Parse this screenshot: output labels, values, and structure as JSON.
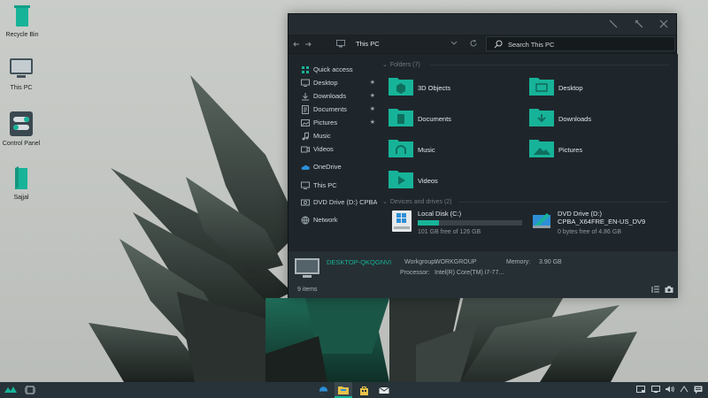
{
  "desktop": {
    "icons": [
      {
        "label": "Recycle Bin"
      },
      {
        "label": "This PC"
      },
      {
        "label": "Control Panel"
      },
      {
        "label": "Sajjal"
      }
    ]
  },
  "window": {
    "controls": [
      "minimize",
      "maximize",
      "close"
    ],
    "address": {
      "location": "This PC"
    },
    "search": {
      "placeholder": "Search This PC"
    },
    "sidebar": [
      {
        "label": "Quick access",
        "icon": "star-icon",
        "pinned": false
      },
      {
        "label": "Desktop",
        "icon": "desktop-icon",
        "pinned": true
      },
      {
        "label": "Downloads",
        "icon": "download-icon",
        "pinned": true
      },
      {
        "label": "Documents",
        "icon": "document-icon",
        "pinned": true
      },
      {
        "label": "Pictures",
        "icon": "picture-icon",
        "pinned": true
      },
      {
        "label": "Music",
        "icon": "music-icon",
        "pinned": false
      },
      {
        "label": "Videos",
        "icon": "video-icon",
        "pinned": false
      },
      {
        "label": "OneDrive",
        "icon": "cloud-icon",
        "pinned": false
      },
      {
        "label": "This PC",
        "icon": "computer-icon",
        "pinned": false
      },
      {
        "label": "DVD Drive (D:) CPBA_",
        "icon": "dvd-icon",
        "pinned": false
      },
      {
        "label": "Network",
        "icon": "network-icon",
        "pinned": false
      }
    ],
    "pin_glyph": "★",
    "folders_header": "Folders (7)",
    "folders": [
      {
        "label": "3D Objects",
        "glyph": "cube"
      },
      {
        "label": "Desktop",
        "glyph": "desktop"
      },
      {
        "label": "Documents",
        "glyph": "doc"
      },
      {
        "label": "Downloads",
        "glyph": "down"
      },
      {
        "label": "Music",
        "glyph": "headphones"
      },
      {
        "label": "Pictures",
        "glyph": "mountain"
      },
      {
        "label": "Videos",
        "glyph": "play"
      }
    ],
    "devices_header": "Devices and drives (2)",
    "drives": [
      {
        "name": "Local Disk (C:)",
        "free_text": "101 GB free of 126 GB",
        "used_fraction": 0.2
      },
      {
        "name": "DVD Drive (D:)",
        "sub": "CPBA_X64FRE_EN-US_DV9",
        "free_text": "0 bytes free of 4.86 GB"
      }
    ],
    "details": {
      "computer_name": "DESKTOP-QKQGNVI",
      "workgroup_label": "Workgroup:",
      "workgroup_value": "WORKGROUP",
      "memory_label": "Memory:",
      "memory_value": "3.90 GB",
      "processor_label": "Processor:",
      "processor_value": "Intel(R) Core(TM) i7-77..."
    },
    "status": {
      "item_count": "9 items"
    }
  },
  "taskbar": {
    "left": [
      "start-icon",
      "task-view-icon"
    ],
    "apps": [
      {
        "name": "edge-icon",
        "active": false
      },
      {
        "name": "file-explorer-icon",
        "active": true
      },
      {
        "name": "store-icon",
        "active": false
      },
      {
        "name": "mail-icon",
        "active": false
      }
    ],
    "tray": [
      "tablet-icon",
      "network-tray-icon",
      "volume-icon",
      "cast-icon",
      "notification-icon"
    ]
  },
  "colors": {
    "accent": "#17b399",
    "folder": "#17b399",
    "window_bg": "#1f262b",
    "taskbar_bg": "#273339"
  }
}
